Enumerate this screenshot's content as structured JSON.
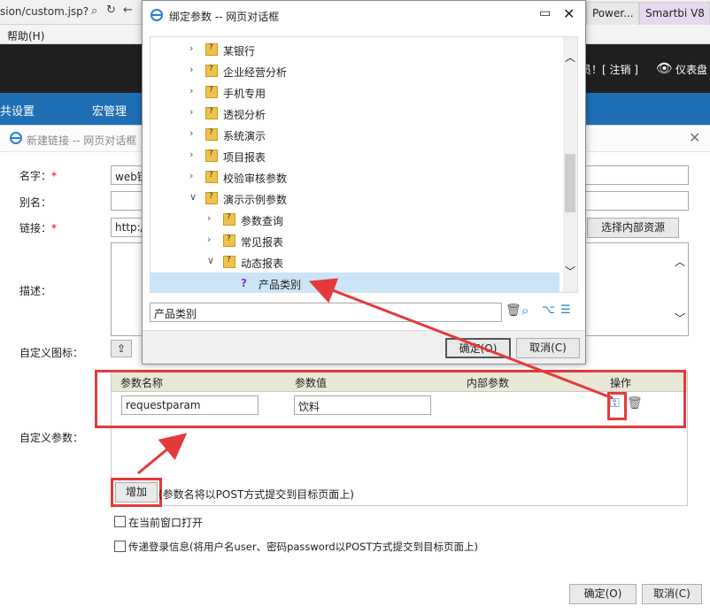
{
  "browser": {
    "address": "sion/custom.jsp?",
    "tabs": [
      {
        "label": "Power..."
      },
      {
        "label": "Smartbi V8"
      }
    ],
    "menu": {
      "help": "帮助(H)"
    }
  },
  "app": {
    "user_text": "员！[ 注销 ]",
    "dashboard_text": "仪表盘",
    "nav": [
      "共设置",
      "宏管理"
    ]
  },
  "new_link_dialog": {
    "title": "新建链接 -- 网页对话框",
    "labels": {
      "name": "名字：",
      "alias": "别名：",
      "link": "链接：",
      "desc": "描述：",
      "icon": "自定义图标：",
      "params": "自定义参数："
    },
    "required_mark": "*",
    "values": {
      "name": "web链",
      "link": "http:/"
    },
    "select_resource": "选择内部资源",
    "params_table": {
      "headers": [
        "参数名称",
        "参数值",
        "内部参数",
        "操作"
      ],
      "rows": [
        {
          "name": "requestparam",
          "value": "饮料"
        }
      ]
    },
    "add_button": "增加",
    "add_note": "(参数名将以POST方式提交到目标页面上)",
    "open_current": "在当前窗口打开",
    "pass_login": "传递登录信息(将用户名user、密码password以POST方式提交到目标页面上)",
    "ok": "确定(O)",
    "cancel": "取消(C)"
  },
  "bind_dialog": {
    "title": "绑定参数 -- 网页对话框",
    "tree": [
      {
        "label": "某银行",
        "level": 0,
        "state": "collapsed"
      },
      {
        "label": "企业经营分析",
        "level": 0,
        "state": "collapsed"
      },
      {
        "label": "手机专用",
        "level": 0,
        "state": "collapsed"
      },
      {
        "label": "透视分析",
        "level": 0,
        "state": "collapsed"
      },
      {
        "label": "系统演示",
        "level": 0,
        "state": "collapsed"
      },
      {
        "label": "项目报表",
        "level": 0,
        "state": "collapsed"
      },
      {
        "label": "校验审核参数",
        "level": 0,
        "state": "collapsed"
      },
      {
        "label": "演示示例参数",
        "level": 0,
        "state": "expanded"
      },
      {
        "label": "参数查询",
        "level": 1,
        "state": "collapsed"
      },
      {
        "label": "常见报表",
        "level": 1,
        "state": "collapsed"
      },
      {
        "label": "动态报表",
        "level": 1,
        "state": "expanded"
      },
      {
        "label": "产品类别",
        "level": 2,
        "state": "leaf",
        "selected": true
      }
    ],
    "search_value": "产品类别",
    "ok": "确定(O)",
    "cancel": "取消(C)"
  },
  "colors": {
    "nav_blue": "#1f6fb5",
    "annotation_red": "#e53a3a",
    "header_dark": "#1f1f1f"
  }
}
